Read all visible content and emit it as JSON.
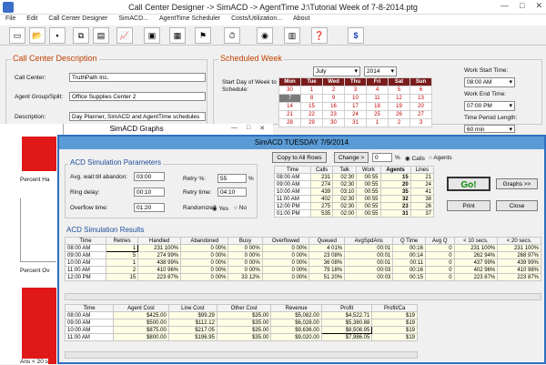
{
  "window": {
    "title": "Call Center Designer -> SimACD -> AgentTime  J:\\Tutorial Week of  7-8-2014.ptg",
    "minimize": "—",
    "maximize": "□",
    "close": "✕"
  },
  "menu": [
    "File",
    "Edit",
    "Call Center Designer",
    "SimACD...",
    "AgentTime Scheduler",
    "Costs/Utilization...",
    "About"
  ],
  "description": {
    "title": "Call Center Description",
    "call_center_label": "Call Center:",
    "call_center_value": "TruthPath Inc.",
    "group_label": "Agent Group/Split:",
    "group_value": "Office Supplies Center 2",
    "desc_label": "Description:",
    "desc_value": "Day Planner, SimACD and AgentTime schedules"
  },
  "scheduled": {
    "title": "Scheduled Week",
    "month": "July",
    "year": "2014",
    "start_day_label": "Start Day of Week to Schedule:",
    "days": [
      "Mon",
      "Tue",
      "Wed",
      "Thu",
      "Fri",
      "Sat",
      "Sun"
    ],
    "rows": [
      [
        "30",
        "1",
        "2",
        "3",
        "4",
        "5",
        "6"
      ],
      [
        "7",
        "8",
        "9",
        "10",
        "11",
        "12",
        "13"
      ],
      [
        "14",
        "15",
        "16",
        "17",
        "18",
        "19",
        "20"
      ],
      [
        "21",
        "22",
        "23",
        "24",
        "25",
        "26",
        "27"
      ],
      [
        "28",
        "29",
        "30",
        "31",
        "1",
        "2",
        "3"
      ]
    ],
    "work_start_label": "Work Start Time:",
    "work_start": "08:00 AM",
    "work_end_label": "Work End Time:",
    "work_end": "07:00 PM",
    "period_label": "Time Period Length:",
    "period": "60 min"
  },
  "graphs": {
    "title": "SimACD Graphs",
    "labels": [
      "Percent Ha",
      "Percent Ov",
      "Ans < 20 s"
    ]
  },
  "simacd": {
    "title": "SimACD    TUESDAY   7/9/2014",
    "copy_btn": "Copy to All Rows",
    "change_btn": "Change >",
    "change_value": "0",
    "change_unit": "%",
    "calls_opt": "Calls",
    "agents_opt": "Agents",
    "params_title": "ACD Simulation Parameters",
    "avg_wait_label": "Avg. wait till abandon:",
    "avg_wait": "03:00",
    "ring_label": "Ring delay:",
    "ring": "00:10",
    "overflow_label": "Overflow time:",
    "overflow": "01:20",
    "retry_pct_label": "Retry %:",
    "retry_pct": "55",
    "retry_time_label": "Retry time:",
    "retry_time": "04:10",
    "randomize_label": "Randomize?",
    "yes": "Yes",
    "no": "No",
    "go": "Go!",
    "graphs_btn": "Graphs >>",
    "print": "Print",
    "close": "Close",
    "top_table": {
      "headers": [
        "Time",
        "Calls",
        "Talk",
        "Work",
        "Agents",
        "Lines"
      ],
      "rows": [
        [
          "08:00 AM",
          "231",
          "02:30",
          "00:55",
          "15",
          "21"
        ],
        [
          "09:00 AM",
          "274",
          "02:30",
          "00:55",
          "20",
          "24"
        ],
        [
          "10:00 AM",
          "439",
          "03:10",
          "00:55",
          "35",
          "41"
        ],
        [
          "11:00 AM",
          "402",
          "02:30",
          "00:55",
          "32",
          "38"
        ],
        [
          "12:00 PM",
          "275",
          "02:30",
          "00:55",
          "23",
          "26"
        ],
        [
          "01:00 PM",
          "535",
          "02:00",
          "00:55",
          "31",
          "37"
        ]
      ]
    },
    "results_title": "ACD Simulation Results",
    "results": {
      "headers": [
        "Time",
        "Retries",
        "Handled",
        "Abandoned",
        "Busy",
        "Overflowed",
        "Queued",
        "AvgSpdAns",
        "Q Time",
        "Avg Q",
        "< 10 secs.",
        "< 20 secs."
      ],
      "rows": [
        [
          "08:00 AM",
          "1",
          "231  100%",
          "0   00%",
          "0   00%",
          "0   00%",
          "4   01%",
          "00:01",
          "00:16",
          "0",
          "231 100%",
          "231 100%"
        ],
        [
          "09:00 AM",
          "5",
          "274   99%",
          "0   00%",
          "0   00%",
          "0   00%",
          "23  08%",
          "00:01",
          "00:14",
          "0",
          "262  94%",
          "268  97%"
        ],
        [
          "10:00 AM",
          "1",
          "438   99%",
          "0   00%",
          "0   00%",
          "0   00%",
          "36  08%",
          "00:01",
          "00:11",
          "0",
          "437  99%",
          "439  99%"
        ],
        [
          "11:00 AM",
          "2",
          "410   96%",
          "0   00%",
          "0   00%",
          "0   00%",
          "79  18%",
          "00:03",
          "00:16",
          "0",
          "402  96%",
          "410  98%"
        ],
        [
          "12:00 PM",
          "15",
          "223   87%",
          "0   00%",
          "33  12%",
          "0   00%",
          "51  20%",
          "00:03",
          "00:15",
          "0",
          "223  87%",
          "223  87%"
        ]
      ]
    },
    "cost_table": {
      "headers": [
        "Time",
        "Agent Cost",
        "Line Cost",
        "Other Cost",
        "Revenue",
        "Profit",
        "Profit/Ca"
      ],
      "rows": [
        [
          "08:00 AM",
          "$425.00",
          "$99.29",
          "$35.00",
          "$5,082.00",
          "$4,522.71",
          "$19"
        ],
        [
          "09:00 AM",
          "$500.00",
          "$112.12",
          "$35.00",
          "$6,028.00",
          "$5,380.88",
          "$19"
        ],
        [
          "10:00 AM",
          "$875.00",
          "$217.05",
          "$35.00",
          "$9,636.00",
          "$8,508.95",
          "$19"
        ],
        [
          "11:00 AM",
          "$800.00",
          "$196.95",
          "$35.00",
          "$9,020.00",
          "$7,986.05",
          "$19"
        ]
      ]
    }
  }
}
